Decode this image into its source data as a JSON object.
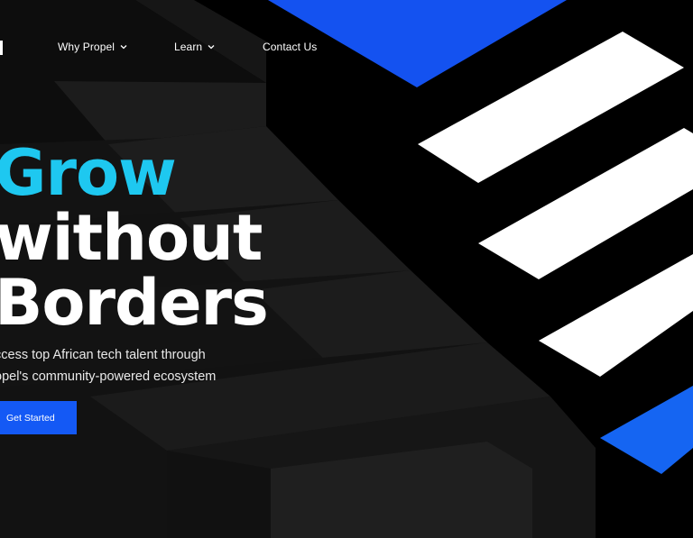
{
  "nav": {
    "items": [
      {
        "label": "Why Propel",
        "icon": "chevron-down-icon"
      },
      {
        "label": "Learn",
        "icon": "chevron-down-icon"
      },
      {
        "label": "Contact Us"
      }
    ]
  },
  "hero": {
    "title_accent": "Grow",
    "title_line2": "without",
    "title_line3": "Borders",
    "subtitle_line1": "ccess top African tech talent through",
    "subtitle_line2": "opel's community-powered ecosystem",
    "cta_label": "Get Started"
  },
  "colors": {
    "background": "#000000",
    "accent_cyan": "#1ec8f0",
    "brand_blue": "#1459f5",
    "stair_dark": "#141414",
    "stair_light": "#1e1e1e"
  }
}
